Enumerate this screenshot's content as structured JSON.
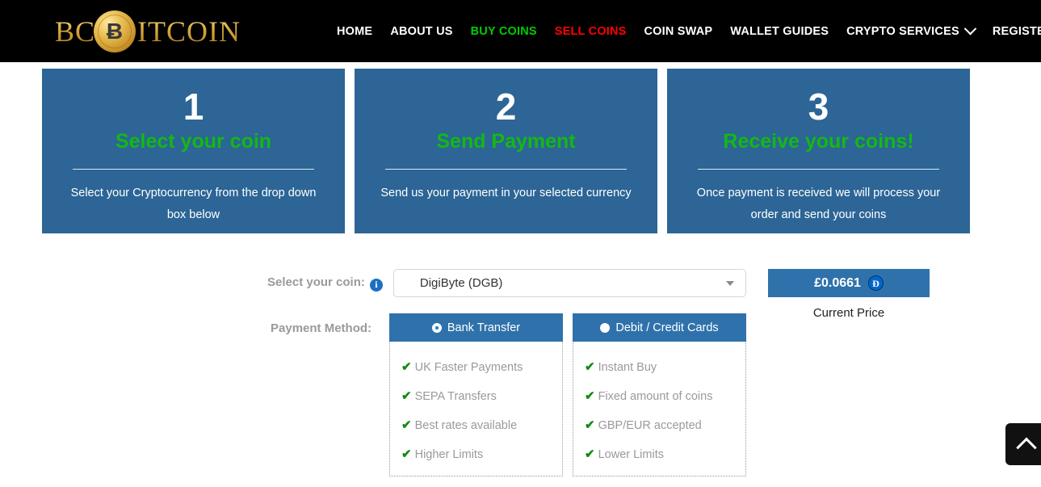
{
  "header": {
    "logo": {
      "pre_text": "BC",
      "coin_glyph": "Ƀ",
      "post_text": "ITCOIN"
    },
    "nav": [
      {
        "label": "HOME",
        "style": "white",
        "caret": false
      },
      {
        "label": "ABOUT US",
        "style": "white",
        "caret": false
      },
      {
        "label": "BUY COINS",
        "style": "green",
        "caret": false
      },
      {
        "label": "SELL COINS",
        "style": "red",
        "caret": false
      },
      {
        "label": "COIN SWAP",
        "style": "white",
        "caret": false
      },
      {
        "label": "WALLET GUIDES",
        "style": "white",
        "caret": false
      },
      {
        "label": "CRYPTO SERVICES",
        "style": "white",
        "caret": true
      },
      {
        "label": "REGISTER",
        "style": "white",
        "caret": true
      }
    ]
  },
  "steps": [
    {
      "number": "1",
      "title": "Select your coin",
      "desc": "Select your Cryptocurrency from the drop down box below"
    },
    {
      "number": "2",
      "title": "Send Payment",
      "desc": "Send us your payment in your selected currency"
    },
    {
      "number": "3",
      "title": "Receive your coins!",
      "desc": "Once payment is received we will process your order and send your coins"
    }
  ],
  "form": {
    "coin_label": "Select your coin:",
    "info_glyph": "i",
    "coin_selected": "DigiByte (DGB)",
    "payment_label": "Payment Method:",
    "methods": [
      {
        "name": "Bank Transfer",
        "selected": true,
        "features": [
          "UK Faster Payments",
          "SEPA Transfers",
          "Best rates available",
          "Higher Limits"
        ]
      },
      {
        "name": "Debit / Credit Cards",
        "selected": false,
        "features": [
          "Instant Buy",
          "Fixed amount of coins",
          "GBP/EUR accepted",
          "Lower Limits"
        ]
      }
    ],
    "tick_glyph": "✔"
  },
  "price": {
    "amount": "£0.0661",
    "coin_glyph": "Ɖ",
    "caption": "Current Price"
  },
  "colors": {
    "card_blue": "#2c6596",
    "tab_blue": "#2f72ab",
    "green": "#14b814",
    "nav_green": "#00cc00",
    "nav_red": "#ff0000",
    "tick_green": "#128a12",
    "label_gray": "#9a9a9a"
  }
}
